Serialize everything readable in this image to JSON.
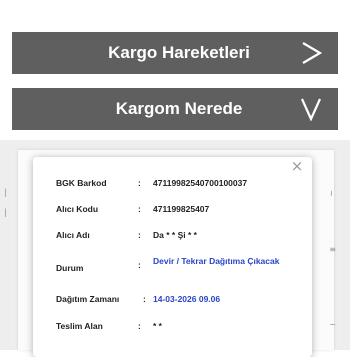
{
  "accordion": [
    {
      "label": "Kargo Hareketleri",
      "icon": "chevron-right-icon"
    },
    {
      "label": "Kargom Nerede",
      "icon": "chevron-down-icon"
    }
  ],
  "modal": {
    "close_label": "×",
    "fields": [
      {
        "label": "BGK Barkod",
        "value": "47119982540700100037",
        "accent": false
      },
      {
        "label": "Alıcı Kodu",
        "value": "471199825407",
        "accent": false
      },
      {
        "label": "Alıcı Adı",
        "value": "Da * * Şi * *",
        "accent": false
      },
      {
        "label": "Durum",
        "value": "Devir / Tekrar Dağıtıma Çıkacak",
        "accent": true
      },
      {
        "label": "Dağıtım Zamanı",
        "value": "14-03-2026 09.06",
        "accent": true
      },
      {
        "label": "Teslim Alan",
        "value": "* *",
        "accent": false
      }
    ]
  },
  "colors": {
    "bar_background": "#5f5f5f",
    "accent": "#2a45c8"
  }
}
